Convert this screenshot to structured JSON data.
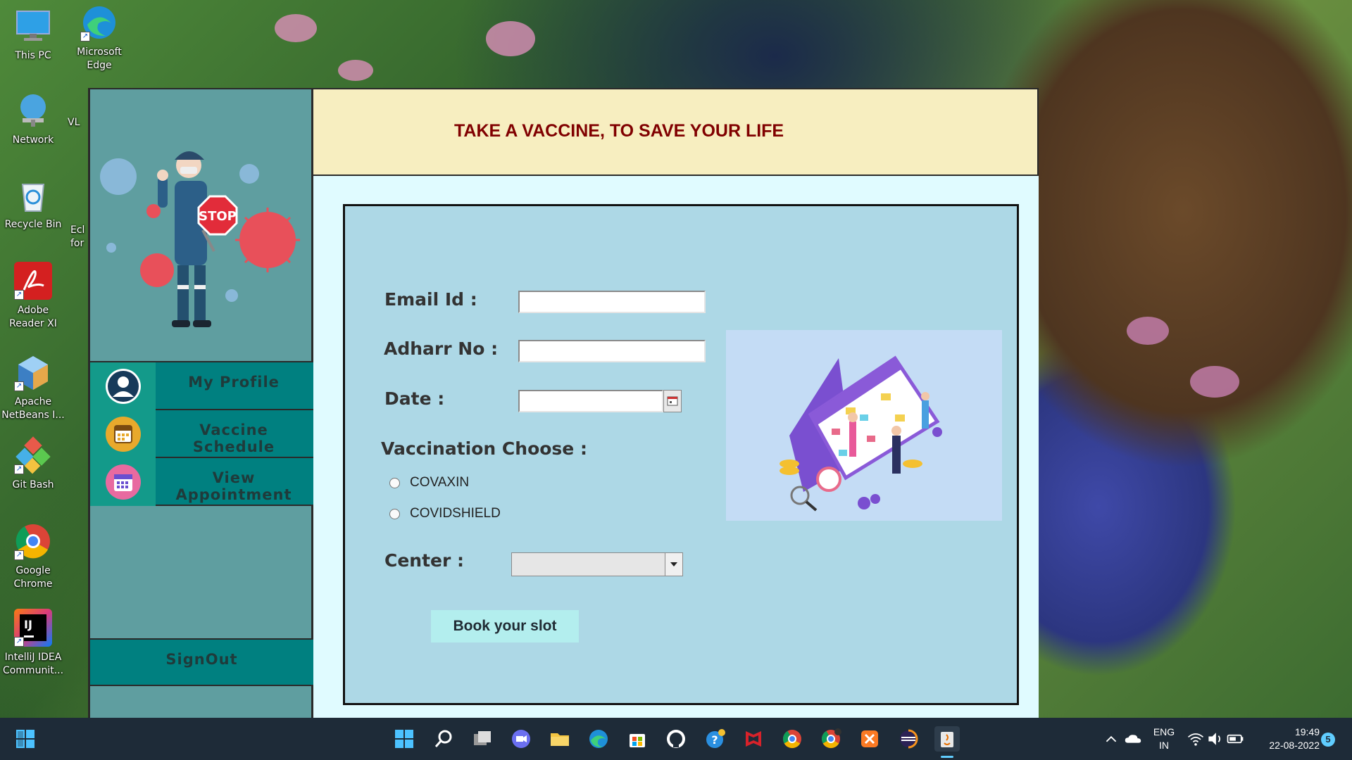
{
  "desktop": {
    "icons": [
      {
        "label": "This PC"
      },
      {
        "label": "Microsoft Edge"
      },
      {
        "label": "Network"
      },
      {
        "label": "VL"
      },
      {
        "label": "Recycle Bin"
      },
      {
        "label": "Ecl for"
      },
      {
        "label": "Adobe Reader XI"
      },
      {
        "label": "Apache NetBeans I..."
      },
      {
        "label": "Git Bash"
      },
      {
        "label": "Google Chrome"
      },
      {
        "label": "IntelliJ IDEA Communit..."
      }
    ]
  },
  "app": {
    "banner_title": "TAKE A VACCINE, TO SAVE YOUR LIFE",
    "hero_sign": "STOP",
    "menu": [
      {
        "label": "My Profile",
        "icon": "user-icon"
      },
      {
        "label": "Vaccine Schedule",
        "icon": "calendar-icon"
      },
      {
        "label": "View Appointment",
        "icon": "appointment-icon"
      }
    ],
    "signout_label": "SignOut",
    "form": {
      "email_label": "Email Id :",
      "email_value": "",
      "adhar_label": "Adharr No :",
      "adhar_value": "",
      "date_label": "Date :",
      "date_value": "",
      "vaccination_label": "Vaccination Choose :",
      "options": [
        "COVAXIN",
        "COVIDSHIELD"
      ],
      "center_label": "Center :",
      "center_value": "",
      "submit_label": "Book your slot"
    }
  },
  "taskbar": {
    "language": "ENG",
    "region": "IN",
    "time": "19:49",
    "date": "22-08-2022",
    "notification_count": "5"
  },
  "colors": {
    "sidebar": "#5f9ea0",
    "menu": "#008080",
    "banner": "#f7eec0",
    "banner_text": "#800000",
    "panel": "#add8e6",
    "button": "#b3eeee"
  }
}
